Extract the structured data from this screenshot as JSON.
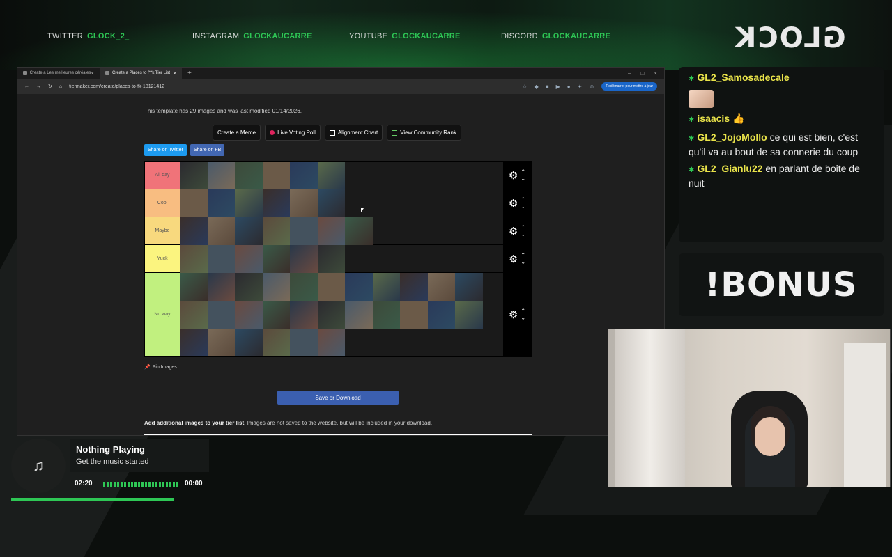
{
  "socials": [
    {
      "label": "TWITTER",
      "handle": "GLOCK_2_"
    },
    {
      "label": "INSTAGRAM",
      "handle": "GLOCKAUCARRE"
    },
    {
      "label": "YOUTUBE",
      "handle": "GLOCKAUCARRE"
    },
    {
      "label": "DISCORD",
      "handle": "GLOCKAUCARRE"
    }
  ],
  "logo": "GLOCK",
  "browser": {
    "tabs": [
      {
        "label": "Create a Les meilleures céréales"
      },
      {
        "label": "Create a Places to f**k Tier List"
      }
    ],
    "url": "tiermaker.com/create/places-to-fk-18121412",
    "restart_label": "Redémarrer pour mettre à jour"
  },
  "page": {
    "template_info": "This template has 29 images and was last modified 01/14/2026.",
    "buttons": {
      "meme": "Create a Meme",
      "poll": "Live Voting Poll",
      "alignment": "Alignment Chart",
      "community": "View Community Rank"
    },
    "share_twitter": "Share on Twitter",
    "share_fb": "Share on FB",
    "tiers": [
      {
        "label": "All day",
        "color": "#f07379",
        "count": 6
      },
      {
        "label": "Cool",
        "color": "#f8bd81",
        "count": 6
      },
      {
        "label": "Maybe",
        "color": "#f8d97e",
        "count": 7
      },
      {
        "label": "Yuck",
        "color": "#fbf47f",
        "count": 6
      },
      {
        "label": "No way",
        "color": "#c1f07f",
        "count": 28
      }
    ],
    "pin_label": "Pin Images",
    "save_label": "Save or Download",
    "add_images_bold": "Add additional images to your tier list",
    "add_images_rest": ". Images are not saved to the website, but will be included in your download."
  },
  "chat": [
    {
      "user": "GL2_Samosadecale",
      "text": "",
      "emote": true
    },
    {
      "user": "isaacis",
      "text": " 👍",
      "emote": false
    },
    {
      "user": "GL2_JojoMollo",
      "text": " ce qui est bien, c'est qu'il va au bout de sa connerie du coup",
      "emote": false
    },
    {
      "user": "GL2_Gianlu22",
      "text": " en parlant de boite de nuit",
      "emote": false
    }
  ],
  "bonus": "!BONUS",
  "player": {
    "title": "Nothing Playing",
    "subtitle": "Get the music started",
    "elapsed": "02:20",
    "remaining": "00:00",
    "progress": 1.0
  }
}
